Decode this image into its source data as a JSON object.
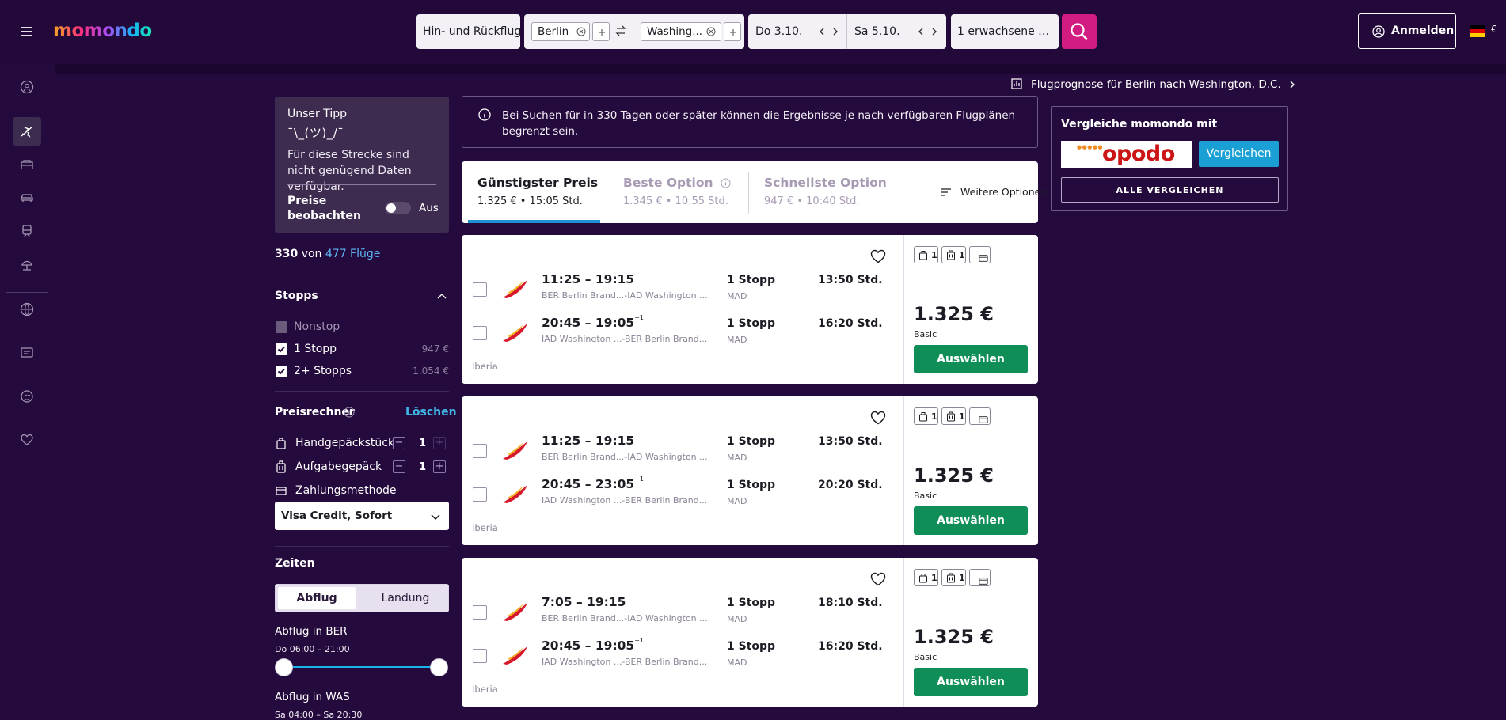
{
  "brand": {
    "logo_text": "momondo",
    "accent": "#d31c81",
    "select_green": "#108e58",
    "link_blue": "#41b7e9"
  },
  "search": {
    "trip_type": "Hin- und Rückflug",
    "origin": "Berlin",
    "destination": "Washing...",
    "depart_date": "Do 3.10.",
    "return_date": "Sa 5.10.",
    "passengers": "1 erwachsene Pe..."
  },
  "header": {
    "sign_in": "Anmelden",
    "currency": "€"
  },
  "rail": [
    "info-icon",
    "flights-icon",
    "hotels-icon",
    "cars-icon",
    "trains-icon",
    "packages-icon",
    "explore-icon",
    "trips-icon",
    "travel-guides-icon",
    "saved-icon"
  ],
  "forecast": {
    "label": "Flugprognose für Berlin nach Washington, D.C."
  },
  "tip": {
    "title": "Unser Tipp",
    "emoji": "¯\\_(ツ)_/¯",
    "text": "Für diese Strecke sind nicht genügend Daten verfügbar.",
    "watch_label": "Preise beobachten",
    "toggle_state": "Aus"
  },
  "results_count": {
    "shown": "330",
    "von": "von",
    "total": "477 Flüge"
  },
  "filters": {
    "stops": {
      "title": "Stopps",
      "options": [
        {
          "label": "Nonstop",
          "price": "",
          "checked": false,
          "disabled": true
        },
        {
          "label": "1 Stopp",
          "price": "947 €",
          "checked": true,
          "disabled": false
        },
        {
          "label": "2+ Stopps",
          "price": "1.054 €",
          "checked": true,
          "disabled": false
        }
      ]
    },
    "price_calc": {
      "title": "Preisrechner",
      "clear": "Löschen",
      "carry_on": {
        "label": "Handgepäckstück",
        "value": "1"
      },
      "checked_bag": {
        "label": "Aufgabegepäck",
        "value": "1"
      },
      "payment_label": "Zahlungsmethode",
      "payment_value": "Visa Credit, Sofort"
    },
    "times": {
      "title": "Zeiten",
      "tabs": [
        "Abflug",
        "Landung"
      ],
      "active_tab": "Abflug",
      "sliders": [
        {
          "label": "Abflug in BER",
          "range": "Do 06:00 – 21:00"
        },
        {
          "label": "Abflug in WAS",
          "range": "Sa 04:00 – Sa 20:30"
        }
      ]
    }
  },
  "notice": "Bei Suchen für in 330 Tagen oder später können die Ergebnisse je nach verfügbaren Flugplänen begrenzt sein.",
  "sort": {
    "tabs": [
      {
        "title": "Günstigster Preis",
        "sub": "1.325 € • 15:05 Std.",
        "active": true
      },
      {
        "title": "Beste Option",
        "sub": "1.345 € • 10:55 Std.",
        "active": false
      },
      {
        "title": "Schnellste Option",
        "sub": "947 € • 10:40 Std.",
        "active": false
      }
    ],
    "more": "Weitere Optionen"
  },
  "results": [
    {
      "legs": [
        {
          "time": "11:25 – 19:15",
          "plus": "",
          "route": "BER Berlin Brand...-IAD Washington ...",
          "stops": "1 Stopp",
          "via": "MAD",
          "duration": "13:50 Std."
        },
        {
          "time": "20:45 – 19:05",
          "plus": "+1",
          "route": "IAD Washington ...-BER Berlin Brand...",
          "stops": "1 Stopp",
          "via": "MAD",
          "duration": "16:20 Std."
        }
      ],
      "airline": "Iberia",
      "carry_on": "1",
      "checked": "1",
      "price": "1.325 €",
      "fare": "Basic",
      "select": "Auswählen"
    },
    {
      "legs": [
        {
          "time": "11:25 – 19:15",
          "plus": "",
          "route": "BER Berlin Brand...-IAD Washington ...",
          "stops": "1 Stopp",
          "via": "MAD",
          "duration": "13:50 Std."
        },
        {
          "time": "20:45 – 23:05",
          "plus": "+1",
          "route": "IAD Washington ...-BER Berlin Brand...",
          "stops": "1 Stopp",
          "via": "MAD",
          "duration": "20:20 Std."
        }
      ],
      "airline": "Iberia",
      "carry_on": "1",
      "checked": "1",
      "price": "1.325 €",
      "fare": "Basic",
      "select": "Auswählen"
    },
    {
      "legs": [
        {
          "time": "7:05 – 19:15",
          "plus": "",
          "route": "BER Berlin Brand...-IAD Washington ...",
          "stops": "1 Stopp",
          "via": "MAD",
          "duration": "18:10 Std."
        },
        {
          "time": "20:45 – 19:05",
          "plus": "+1",
          "route": "IAD Washington ...-BER Berlin Brand...",
          "stops": "1 Stopp",
          "via": "MAD",
          "duration": "16:20 Std."
        }
      ],
      "airline": "Iberia",
      "carry_on": "1",
      "checked": "1",
      "price": "1.325 €",
      "fare": "Basic",
      "select": "Auswählen"
    }
  ],
  "compare": {
    "title": "Vergleiche momondo mit",
    "partner": "opodo",
    "compare_btn": "Vergleichen",
    "compare_all": "ALLE VERGLEICHEN"
  }
}
